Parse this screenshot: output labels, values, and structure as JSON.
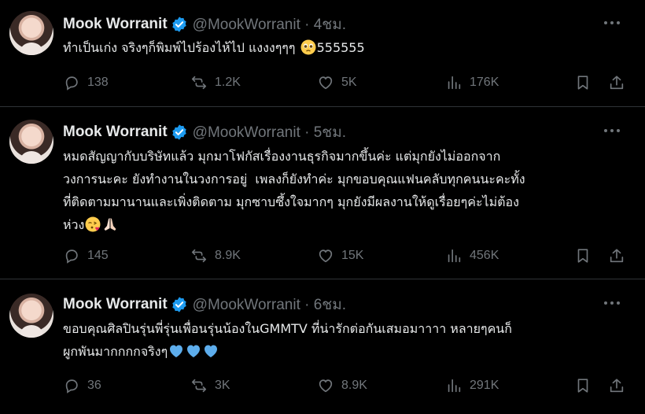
{
  "tweets": [
    {
      "name": "Mook Worranit",
      "handle": "@MookWorranit · 4ชม.",
      "text": "ทำเป็นเก่ง จริงๆก็พิมพ์ไปร้องไห้ไป แงงงๆๆๆ ",
      "text_after": "555555",
      "emojis": [
        "pleading-face"
      ],
      "replies": "138",
      "reposts": "1.2K",
      "likes": "5K",
      "views": "176K"
    },
    {
      "name": "Mook Worranit",
      "handle": "@MookWorranit · 5ชม.",
      "text": "หมดสัญญากับบริษัทแล้ว มุกมาโฟกัสเรื่องงานธุรกิจมากขึ้นค่ะ แต่มุกยังไม่ออกจาก\nวงการนะคะ ยังทำงานในวงการอยู่  เพลงก็ยังทำค่ะ มุกขอบคุณแฟนคลับทุกคนนะคะทั้ง\nที่ติดตามมานานและเพิ่งติดตาม มุกซาบซึ้งใจมากๆ มุกยังมีผลงานให้ดูเรื่อยๆค่ะไม่ต้อง\nห่วง",
      "text_after": "",
      "emojis": [
        "face-blowing-kiss",
        "folded-hands"
      ],
      "replies": "145",
      "reposts": "8.9K",
      "likes": "15K",
      "views": "456K"
    },
    {
      "name": "Mook Worranit",
      "handle": "@MookWorranit · 6ชม.",
      "text": "ขอบคุณศิลปินรุ่นพี่รุ่นเพื่อนรุ่นน้องในGMMTV ที่น่ารักต่อกันเสมอมาาาา หลายๆคนก็\nผูกพันมากกกกจริงๆ",
      "text_after": "",
      "emojis": [
        "blue-heart",
        "blue-heart",
        "blue-heart"
      ],
      "replies": "36",
      "reposts": "3K",
      "likes": "8.9K",
      "views": "291K"
    }
  ],
  "colors": {
    "background": "#000000",
    "text": "#e7e9ea",
    "muted": "#71767b",
    "verified": "#1d9bf0",
    "divider": "#2f3336"
  }
}
